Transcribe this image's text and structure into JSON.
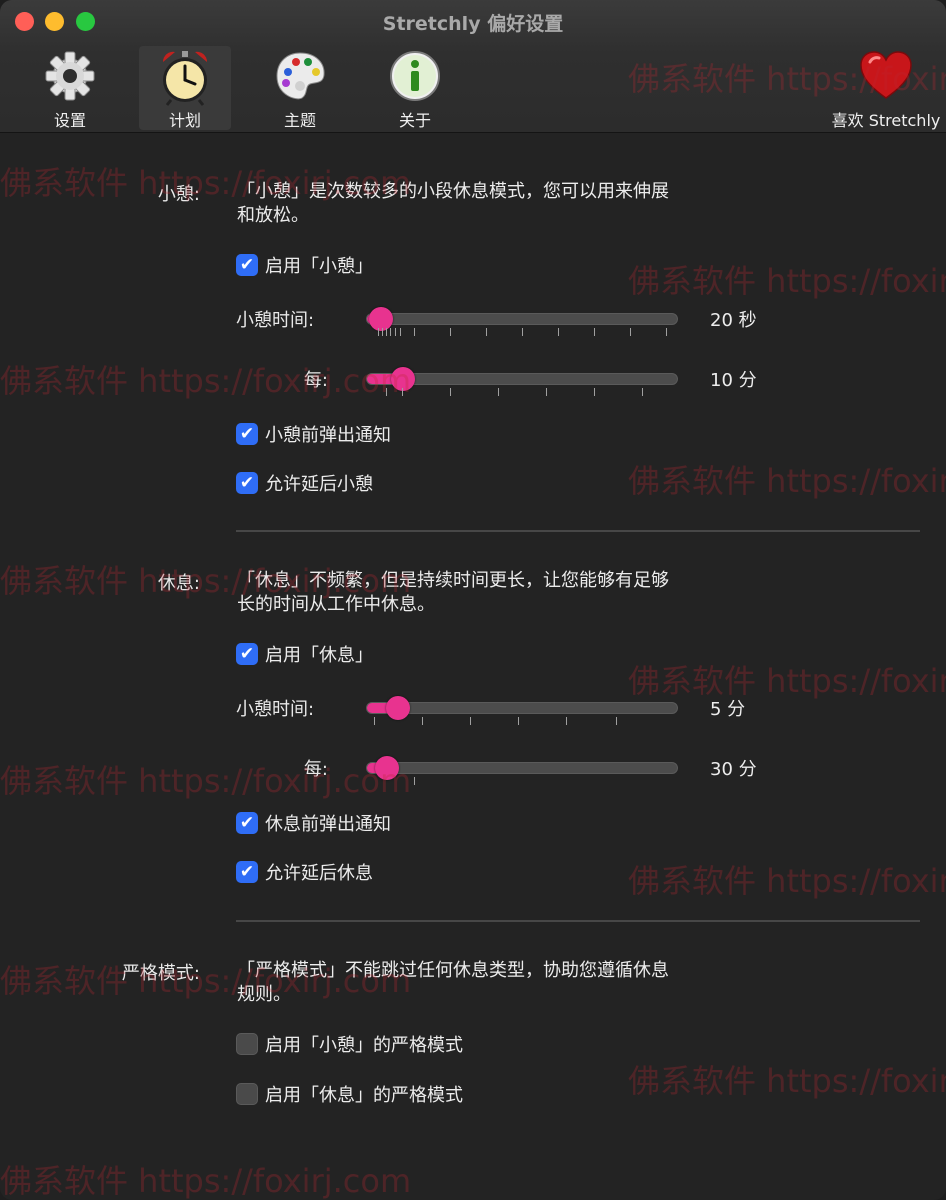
{
  "window": {
    "title": "Stretchly 偏好设置"
  },
  "toolbar": {
    "items": [
      {
        "label": "设置",
        "icon": "gear-icon"
      },
      {
        "label": "计划",
        "icon": "alarm-clock-icon",
        "selected": true
      },
      {
        "label": "主题",
        "icon": "palette-icon"
      },
      {
        "label": "关于",
        "icon": "info-icon"
      },
      {
        "label": "喜欢 Stretchly",
        "icon": "heart-icon"
      }
    ]
  },
  "mini_break": {
    "label": "小憩:",
    "description": "「小憩」是次数较多的小段休息模式，您可以用来伸展和放松。",
    "enable": {
      "label": "启用「小憩」",
      "checked": true
    },
    "duration": {
      "label": "小憩时间:",
      "value": "20 秒"
    },
    "interval": {
      "label": "每:",
      "value": "10 分"
    },
    "notify": {
      "label": "小憩前弹出通知",
      "checked": true
    },
    "postpone": {
      "label": "允许延后小憩",
      "checked": true
    }
  },
  "long_break": {
    "label": "休息:",
    "description": "「休息」不频繁，但是持续时间更长，让您能够有足够长的时间从工作中休息。",
    "enable": {
      "label": "启用「休息」",
      "checked": true
    },
    "duration": {
      "label": "小憩时间:",
      "value": "5 分"
    },
    "interval": {
      "label": "每:",
      "value": "30 分"
    },
    "notify": {
      "label": "休息前弹出通知",
      "checked": true
    },
    "postpone": {
      "label": "允许延后休息",
      "checked": true
    }
  },
  "strict_mode": {
    "label": "严格模式:",
    "description": "「严格模式」不能跳过任何休息类型，协助您遵循休息规则。",
    "mini": {
      "label": "启用「小憩」的严格模式",
      "checked": false
    },
    "long": {
      "label": "启用「休息」的严格模式",
      "checked": false
    }
  },
  "watermark": {
    "text": "佛系软件 https://foxirj.com"
  },
  "colors": {
    "accent": "#e8338f",
    "checkbox": "#2f6df6",
    "background": "#232323"
  }
}
